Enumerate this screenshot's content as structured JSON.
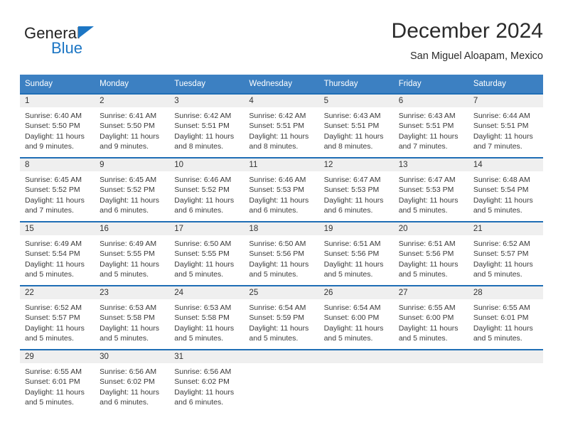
{
  "brand": {
    "name_part1": "General",
    "name_part2": "Blue",
    "triangle_color": "#1c76c4"
  },
  "header": {
    "title": "December 2024",
    "subtitle": "San Miguel Aloapam, Mexico"
  },
  "colors": {
    "header_blue": "#3c80c2",
    "row_border_blue": "#1f6eb5",
    "day_strip_gray": "#efefef",
    "text": "#3a3a3a"
  },
  "weekdays": [
    "Sunday",
    "Monday",
    "Tuesday",
    "Wednesday",
    "Thursday",
    "Friday",
    "Saturday"
  ],
  "weeks": [
    [
      {
        "day": "1",
        "sunrise": "Sunrise: 6:40 AM",
        "sunset": "Sunset: 5:50 PM",
        "daylight": "Daylight: 11 hours and 9 minutes."
      },
      {
        "day": "2",
        "sunrise": "Sunrise: 6:41 AM",
        "sunset": "Sunset: 5:50 PM",
        "daylight": "Daylight: 11 hours and 9 minutes."
      },
      {
        "day": "3",
        "sunrise": "Sunrise: 6:42 AM",
        "sunset": "Sunset: 5:51 PM",
        "daylight": "Daylight: 11 hours and 8 minutes."
      },
      {
        "day": "4",
        "sunrise": "Sunrise: 6:42 AM",
        "sunset": "Sunset: 5:51 PM",
        "daylight": "Daylight: 11 hours and 8 minutes."
      },
      {
        "day": "5",
        "sunrise": "Sunrise: 6:43 AM",
        "sunset": "Sunset: 5:51 PM",
        "daylight": "Daylight: 11 hours and 8 minutes."
      },
      {
        "day": "6",
        "sunrise": "Sunrise: 6:43 AM",
        "sunset": "Sunset: 5:51 PM",
        "daylight": "Daylight: 11 hours and 7 minutes."
      },
      {
        "day": "7",
        "sunrise": "Sunrise: 6:44 AM",
        "sunset": "Sunset: 5:51 PM",
        "daylight": "Daylight: 11 hours and 7 minutes."
      }
    ],
    [
      {
        "day": "8",
        "sunrise": "Sunrise: 6:45 AM",
        "sunset": "Sunset: 5:52 PM",
        "daylight": "Daylight: 11 hours and 7 minutes."
      },
      {
        "day": "9",
        "sunrise": "Sunrise: 6:45 AM",
        "sunset": "Sunset: 5:52 PM",
        "daylight": "Daylight: 11 hours and 6 minutes."
      },
      {
        "day": "10",
        "sunrise": "Sunrise: 6:46 AM",
        "sunset": "Sunset: 5:52 PM",
        "daylight": "Daylight: 11 hours and 6 minutes."
      },
      {
        "day": "11",
        "sunrise": "Sunrise: 6:46 AM",
        "sunset": "Sunset: 5:53 PM",
        "daylight": "Daylight: 11 hours and 6 minutes."
      },
      {
        "day": "12",
        "sunrise": "Sunrise: 6:47 AM",
        "sunset": "Sunset: 5:53 PM",
        "daylight": "Daylight: 11 hours and 6 minutes."
      },
      {
        "day": "13",
        "sunrise": "Sunrise: 6:47 AM",
        "sunset": "Sunset: 5:53 PM",
        "daylight": "Daylight: 11 hours and 5 minutes."
      },
      {
        "day": "14",
        "sunrise": "Sunrise: 6:48 AM",
        "sunset": "Sunset: 5:54 PM",
        "daylight": "Daylight: 11 hours and 5 minutes."
      }
    ],
    [
      {
        "day": "15",
        "sunrise": "Sunrise: 6:49 AM",
        "sunset": "Sunset: 5:54 PM",
        "daylight": "Daylight: 11 hours and 5 minutes."
      },
      {
        "day": "16",
        "sunrise": "Sunrise: 6:49 AM",
        "sunset": "Sunset: 5:55 PM",
        "daylight": "Daylight: 11 hours and 5 minutes."
      },
      {
        "day": "17",
        "sunrise": "Sunrise: 6:50 AM",
        "sunset": "Sunset: 5:55 PM",
        "daylight": "Daylight: 11 hours and 5 minutes."
      },
      {
        "day": "18",
        "sunrise": "Sunrise: 6:50 AM",
        "sunset": "Sunset: 5:56 PM",
        "daylight": "Daylight: 11 hours and 5 minutes."
      },
      {
        "day": "19",
        "sunrise": "Sunrise: 6:51 AM",
        "sunset": "Sunset: 5:56 PM",
        "daylight": "Daylight: 11 hours and 5 minutes."
      },
      {
        "day": "20",
        "sunrise": "Sunrise: 6:51 AM",
        "sunset": "Sunset: 5:56 PM",
        "daylight": "Daylight: 11 hours and 5 minutes."
      },
      {
        "day": "21",
        "sunrise": "Sunrise: 6:52 AM",
        "sunset": "Sunset: 5:57 PM",
        "daylight": "Daylight: 11 hours and 5 minutes."
      }
    ],
    [
      {
        "day": "22",
        "sunrise": "Sunrise: 6:52 AM",
        "sunset": "Sunset: 5:57 PM",
        "daylight": "Daylight: 11 hours and 5 minutes."
      },
      {
        "day": "23",
        "sunrise": "Sunrise: 6:53 AM",
        "sunset": "Sunset: 5:58 PM",
        "daylight": "Daylight: 11 hours and 5 minutes."
      },
      {
        "day": "24",
        "sunrise": "Sunrise: 6:53 AM",
        "sunset": "Sunset: 5:58 PM",
        "daylight": "Daylight: 11 hours and 5 minutes."
      },
      {
        "day": "25",
        "sunrise": "Sunrise: 6:54 AM",
        "sunset": "Sunset: 5:59 PM",
        "daylight": "Daylight: 11 hours and 5 minutes."
      },
      {
        "day": "26",
        "sunrise": "Sunrise: 6:54 AM",
        "sunset": "Sunset: 6:00 PM",
        "daylight": "Daylight: 11 hours and 5 minutes."
      },
      {
        "day": "27",
        "sunrise": "Sunrise: 6:55 AM",
        "sunset": "Sunset: 6:00 PM",
        "daylight": "Daylight: 11 hours and 5 minutes."
      },
      {
        "day": "28",
        "sunrise": "Sunrise: 6:55 AM",
        "sunset": "Sunset: 6:01 PM",
        "daylight": "Daylight: 11 hours and 5 minutes."
      }
    ],
    [
      {
        "day": "29",
        "sunrise": "Sunrise: 6:55 AM",
        "sunset": "Sunset: 6:01 PM",
        "daylight": "Daylight: 11 hours and 5 minutes."
      },
      {
        "day": "30",
        "sunrise": "Sunrise: 6:56 AM",
        "sunset": "Sunset: 6:02 PM",
        "daylight": "Daylight: 11 hours and 6 minutes."
      },
      {
        "day": "31",
        "sunrise": "Sunrise: 6:56 AM",
        "sunset": "Sunset: 6:02 PM",
        "daylight": "Daylight: 11 hours and 6 minutes."
      },
      {
        "day": "",
        "sunrise": "",
        "sunset": "",
        "daylight": ""
      },
      {
        "day": "",
        "sunrise": "",
        "sunset": "",
        "daylight": ""
      },
      {
        "day": "",
        "sunrise": "",
        "sunset": "",
        "daylight": ""
      },
      {
        "day": "",
        "sunrise": "",
        "sunset": "",
        "daylight": ""
      }
    ]
  ]
}
